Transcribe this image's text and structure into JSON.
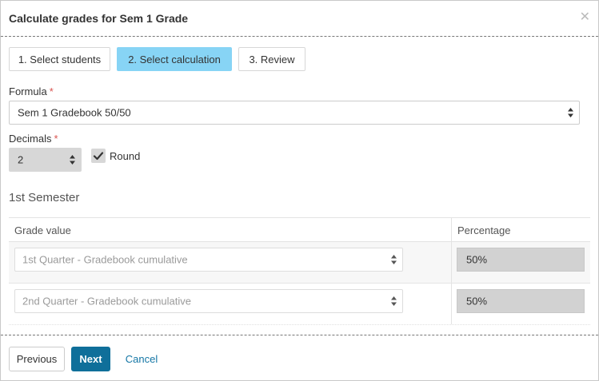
{
  "modal": {
    "title": "Calculate grades for Sem 1 Grade",
    "close_icon": "close-icon"
  },
  "steps": [
    {
      "label": "1. Select students",
      "active": false
    },
    {
      "label": "2. Select calculation",
      "active": true
    },
    {
      "label": "3. Review",
      "active": false
    }
  ],
  "formula": {
    "label": "Formula",
    "required_mark": "*",
    "value": "Sem 1 Gradebook 50/50"
  },
  "decimals": {
    "label": "Decimals",
    "required_mark": "*",
    "value": "2"
  },
  "round": {
    "label": "Round",
    "checked": true
  },
  "section": {
    "title": "1st Semester"
  },
  "grid": {
    "headers": [
      "Grade value",
      "Percentage"
    ],
    "rows": [
      {
        "grade_value": "1st Quarter - Gradebook cumulative",
        "percentage": "50%"
      },
      {
        "grade_value": "2nd Quarter - Gradebook cumulative",
        "percentage": "50%"
      }
    ]
  },
  "footer": {
    "previous_label": "Previous",
    "next_label": "Next",
    "cancel_label": "Cancel"
  },
  "colors": {
    "active_step": "#87d4f5",
    "primary_button": "#0f6f9a",
    "link": "#1476a5",
    "required": "#d9534f"
  }
}
